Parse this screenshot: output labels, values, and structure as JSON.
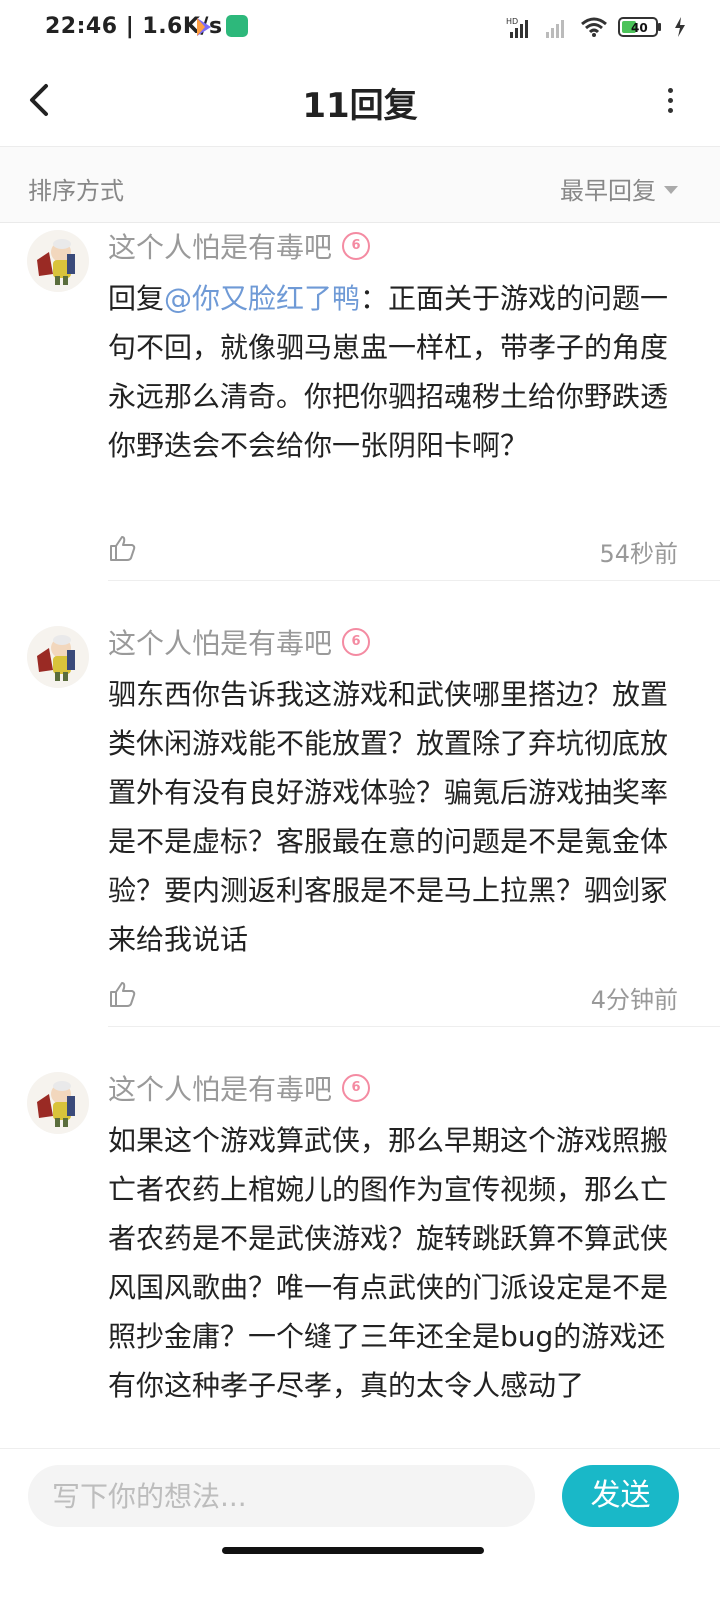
{
  "status_bar": {
    "time_speed": "22:46 | 1.6K/s",
    "battery": "40",
    "network_label": "HD"
  },
  "header": {
    "title": "11回复"
  },
  "sort": {
    "label": "排序方式",
    "selected": "最早回复"
  },
  "comments": [
    {
      "username": "这个人怕是有毒吧",
      "badge": "6",
      "reply_prefix": "回复",
      "mention": "@你又脸红了鸭",
      "text": "：正面关于游戏的问题一句不回，就像驷马崽盅一样杠，带孝子的角度永远那么清奇。你把你驷招魂秽土给你野跌透你野迭会不会给你一张阴阳卡啊？",
      "time": "54秒前"
    },
    {
      "username": "这个人怕是有毒吧",
      "badge": "6",
      "text": "驷东西你告诉我这游戏和武侠哪里搭边？放置类休闲游戏能不能放置？放置除了弃坑彻底放置外有没有良好游戏体验？骗氪后游戏抽奖率是不是虚标？客服最在意的问题是不是氪金体验？要内测返利客服是不是马上拉黑？驷剑冢来给我说话",
      "time": "4分钟前"
    },
    {
      "username": "这个人怕是有毒吧",
      "badge": "6",
      "text": "如果这个游戏算武侠，那么早期这个游戏照搬亡者农药上棺婉儿的图作为宣传视频，那么亡者农药是不是武侠游戏？旋转跳跃算不算武侠风国风歌曲？唯一有点武侠的门派设定是不是照抄金庸？一个缝了三年还全是bug的游戏还有你这种孝子尽孝，真的太令人感动了"
    }
  ],
  "input": {
    "placeholder": "写下你的想法..."
  },
  "send_label": "发送",
  "colors": {
    "accent": "#19b8c8",
    "mention": "#6f9ad6",
    "badge": "#f48ba2"
  }
}
